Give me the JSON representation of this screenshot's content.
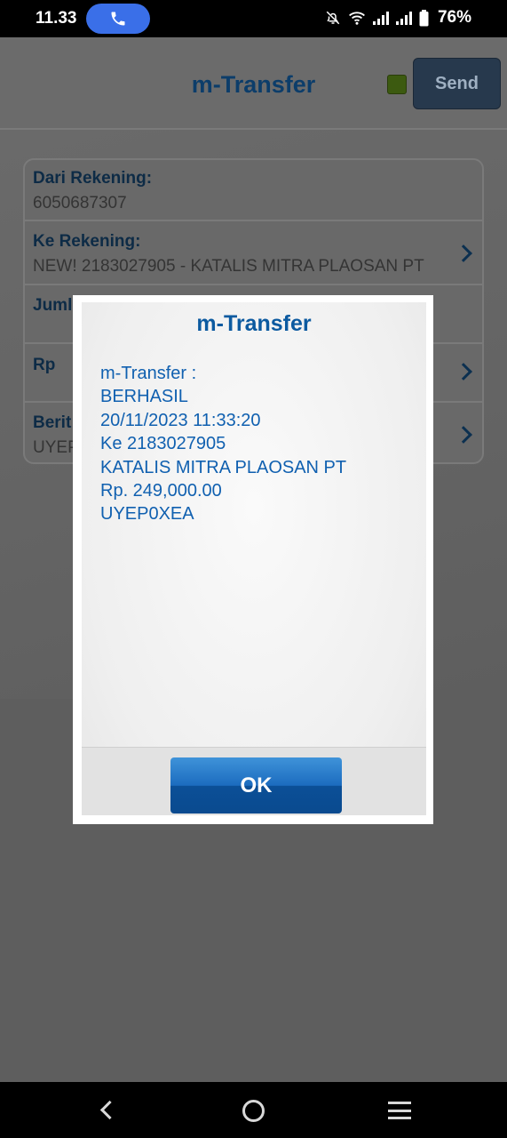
{
  "status_bar": {
    "time": "11.33",
    "battery": "76%",
    "icons": [
      "phone-icon",
      "bell-off-icon",
      "wifi-icon",
      "signal-icon",
      "signal-icon",
      "battery-icon"
    ]
  },
  "header": {
    "title": "m-Transfer",
    "send_label": "Send",
    "status_led_color": "#5a8a1a"
  },
  "form": {
    "rows": [
      {
        "label": "Dari Rekening:",
        "value": "6050687307"
      },
      {
        "label": "Ke Rekening:",
        "value": "NEW! 2183027905 - KATALIS MITRA PLAOSAN PT"
      },
      {
        "label": "Juml",
        "value": ""
      },
      {
        "label": "Rp",
        "value": ""
      },
      {
        "label": "Berit",
        "value": "UYEP"
      }
    ]
  },
  "dialog": {
    "title": "m-Transfer",
    "lines": [
      "m-Transfer :",
      "BERHASIL",
      "20/11/2023 11:33:20",
      "Ke 2183027905",
      "KATALIS MITRA PLAOSAN PT",
      "Rp. 249,000.00",
      "UYEP0XEA"
    ],
    "ok_label": "OK"
  },
  "colors": {
    "brand_blue": "#0c5aa0",
    "ok_button": "#1c6cbf"
  },
  "navbar": {
    "icons": [
      "back-icon",
      "home-icon",
      "recent-apps-icon"
    ]
  }
}
